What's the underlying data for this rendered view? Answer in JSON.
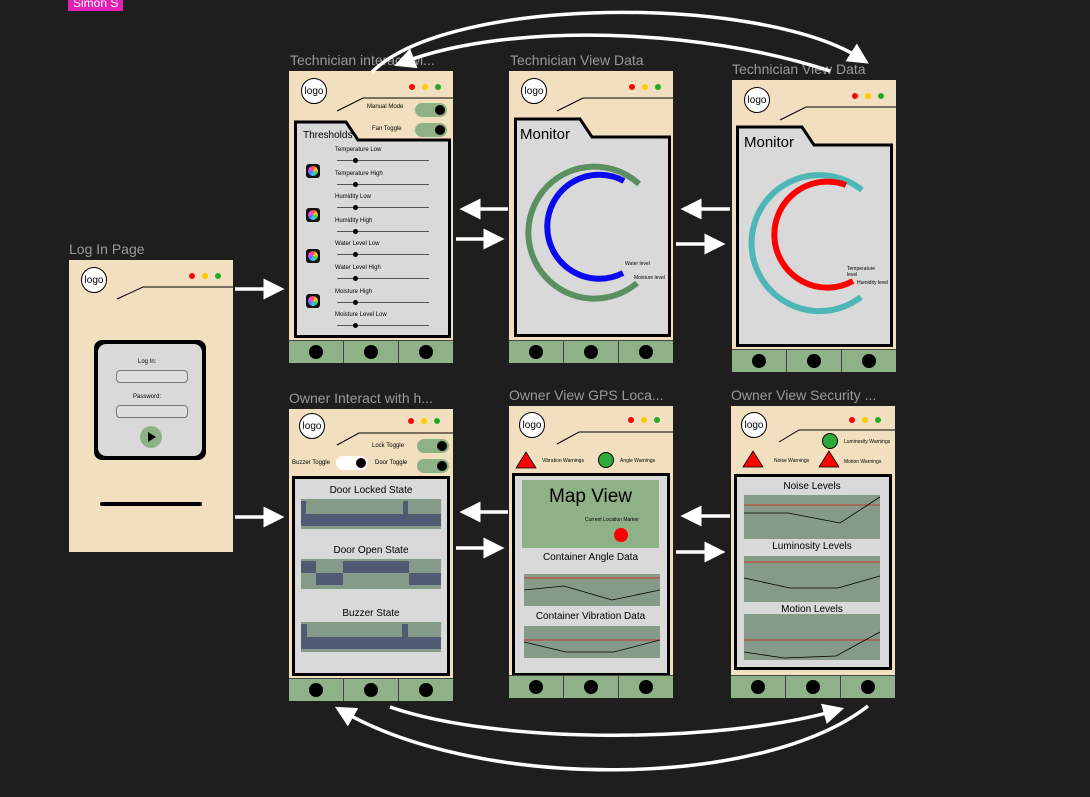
{
  "author_tag": "Simon S",
  "frames": {
    "login": {
      "label": "Log In Page",
      "logo": "logo",
      "login_label": "Log In:",
      "password_label": "Password:"
    },
    "tech_interact": {
      "label": "Technician interact wi...",
      "logo": "logo",
      "manual_mode": "Manual Mode",
      "fan_toggle": "Fan Toggle",
      "thresholds_title": "Thresholds",
      "sliders": [
        "Temperature Low",
        "Temperature High",
        "Humidity Low",
        "Humidity High",
        "Water Level Low",
        "Water Level  High",
        "Moisture  High",
        "Moisture Level Low"
      ]
    },
    "tech_view1": {
      "label": "Technician View Data",
      "logo": "logo",
      "monitor": "Monitor",
      "legend": [
        "Water level",
        "Moisture level"
      ]
    },
    "tech_view2": {
      "label": "Technician View Data",
      "logo": "logo",
      "monitor": "Monitor",
      "legend": [
        "Temperature level",
        "Humidity level"
      ]
    },
    "owner_interact": {
      "label": "Owner Interact with h...",
      "logo": "logo",
      "lock_toggle": "Lock Toggle",
      "buzzer_toggle": "Buzzer Toggle",
      "door_toggle": "Door Toggle",
      "charts": [
        "Door Locked State",
        "Door Open State",
        "Buzzer State"
      ]
    },
    "owner_gps": {
      "label": "Owner View GPS Loca...",
      "logo": "logo",
      "vibration_warnings": "Vibration Warnings",
      "angle_warnings": "Angle Warnings",
      "map_view": "Map View",
      "marker_label": "Current Location Marker",
      "charts": [
        "Container Angle Data",
        "Container Vibration Data"
      ]
    },
    "owner_security": {
      "label": "Owner View Security ...",
      "logo": "logo",
      "luminosity_warnings": "Luminosity Warnings",
      "noise_warnings": "Noise Warnings",
      "motion_warnings": "Motion Warnings",
      "charts": [
        "Noise Levels",
        "Luminosity Levels",
        "Motion Levels"
      ]
    }
  },
  "colors": {
    "canvas": "#1e1e1e",
    "phone": "#f2dfc0",
    "panel": "#d9d9d9",
    "nav": "#8fb187",
    "chart": "#869a89",
    "tag": "#e21fb6"
  }
}
